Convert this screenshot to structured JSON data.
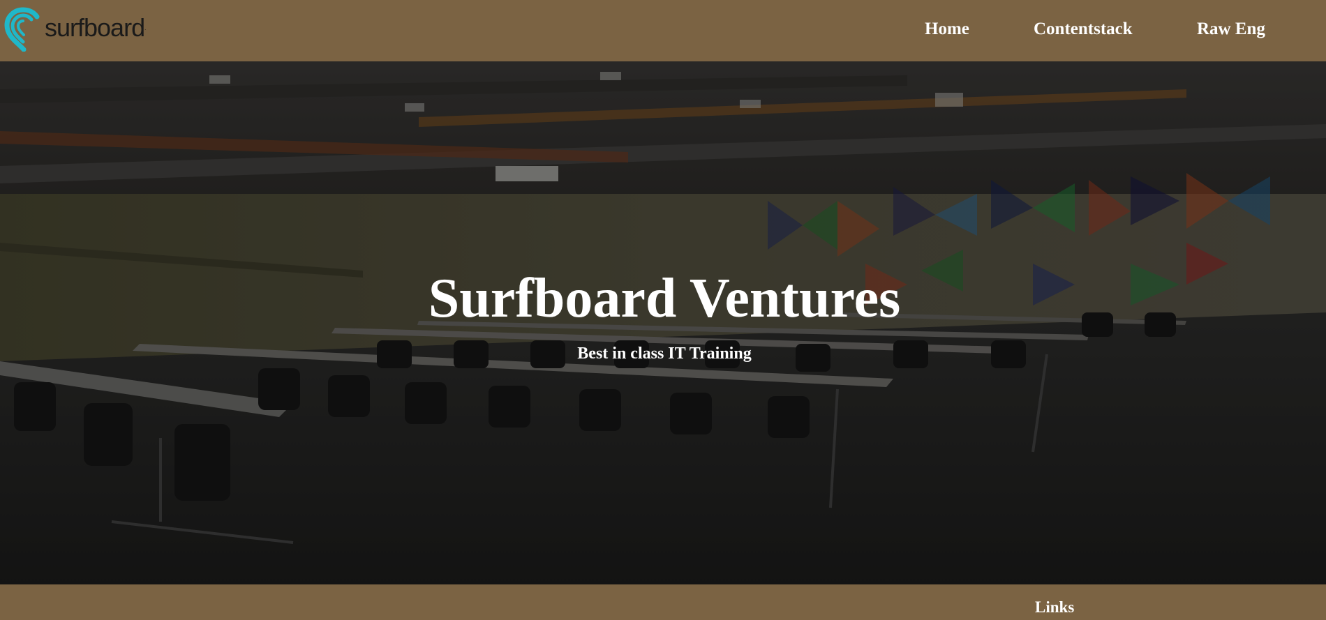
{
  "header": {
    "logo_text": "surfboard",
    "logo_mark": ".",
    "logo_icon": "surfboard-wave-pin-icon",
    "nav": [
      {
        "label": "Home"
      },
      {
        "label": "Contentstack"
      },
      {
        "label": "Raw Eng"
      }
    ]
  },
  "hero": {
    "title": "Surfboard Ventures",
    "subtitle": "Best in class IT Training",
    "background": "training-room-photo"
  },
  "footer": {
    "links_heading": "Links"
  },
  "colors": {
    "brand_bar": "#7b6343",
    "logo_accent": "#1fb8c9",
    "text": "#ffffff"
  }
}
